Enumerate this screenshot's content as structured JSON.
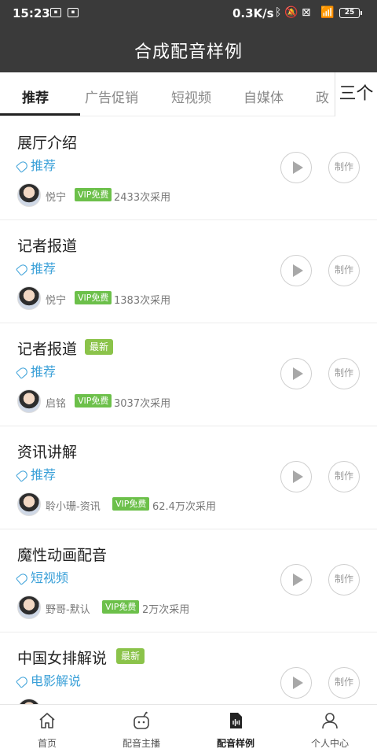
{
  "status_bar": {
    "time": "15:23",
    "net_speed": "0.3K/s",
    "battery": "25"
  },
  "header": {
    "title": "合成配音样例"
  },
  "tabs": [
    {
      "label": "推荐",
      "active": true
    },
    {
      "label": "广告促销",
      "active": false
    },
    {
      "label": "短视频",
      "active": false
    },
    {
      "label": "自媒体",
      "active": false
    },
    {
      "label": "政",
      "active": false
    }
  ],
  "tab_more_label": "三个",
  "items": [
    {
      "title": "展厅介绍",
      "badge": "",
      "tag": "推荐",
      "speaker": "悦宁",
      "vip": "VIP免费",
      "uses": "2433次采用",
      "make": "制作"
    },
    {
      "title": "记者报道",
      "badge": "",
      "tag": "推荐",
      "speaker": "悦宁",
      "vip": "VIP免费",
      "uses": "1383次采用",
      "make": "制作"
    },
    {
      "title": "记者报道",
      "badge": "最新",
      "tag": "推荐",
      "speaker": "启铭",
      "vip": "VIP免费",
      "uses": "3037次采用",
      "make": "制作"
    },
    {
      "title": "资讯讲解",
      "badge": "",
      "tag": "推荐",
      "speaker": "聆小珊-资讯",
      "vip": "VIP免费",
      "uses": "62.4万次采用",
      "make": "制作"
    },
    {
      "title": "魔性动画配音",
      "badge": "",
      "tag": "短视频",
      "speaker": "野哥-默认",
      "vip": "VIP免费",
      "uses": "2万次采用",
      "make": "制作"
    },
    {
      "title": "中国女排解说",
      "badge": "最新",
      "tag": "电影解说",
      "speaker": "",
      "vip": "",
      "uses": "",
      "make": "制作"
    }
  ],
  "bottom_nav": [
    {
      "label": "首页",
      "icon": "home-icon",
      "active": false
    },
    {
      "label": "配音主播",
      "icon": "robot-icon",
      "active": false
    },
    {
      "label": "配音样例",
      "icon": "audio-file-icon",
      "active": true
    },
    {
      "label": "个人中心",
      "icon": "person-icon",
      "active": false
    }
  ],
  "colors": {
    "header_bg": "#3a3a3a",
    "tag_blue": "#3aa0d8",
    "vip_green": "#6cc04a",
    "new_badge_green": "#8bc34a"
  }
}
